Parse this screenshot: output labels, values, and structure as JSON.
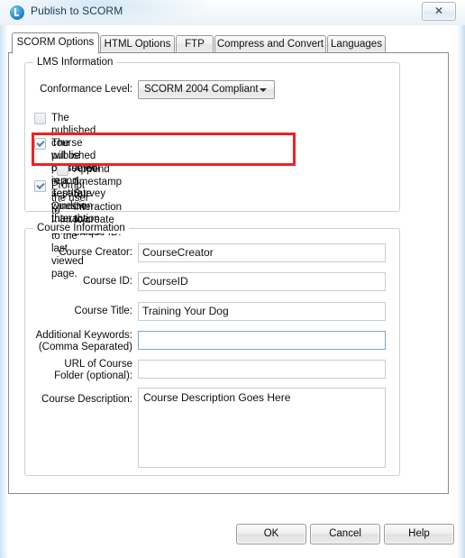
{
  "window": {
    "title": "Publish to SCORM",
    "app_icon": "lectora-logo-icon",
    "close_label": "✕"
  },
  "tabs": [
    {
      "label": "SCORM Options",
      "active": true
    },
    {
      "label": "HTML Options",
      "active": false
    },
    {
      "label": "FTP",
      "active": false
    },
    {
      "label": "Compress and Convert",
      "active": false
    },
    {
      "label": "Languages",
      "active": false
    }
  ],
  "lms_information": {
    "group_label": "LMS Information",
    "conformance_label": "Conformance Level:",
    "conformance_value": "SCORM 2004 Compliant",
    "checkboxes": [
      {
        "label": "The published course will be presented in a separate\nwindow than the LMS.",
        "checked": false,
        "indented": false
      },
      {
        "label": "The published course will report Test/Survey Question\nInteraction to the LMS.",
        "checked": true,
        "indented": false
      },
      {
        "label": "Append timestamp to interaction to create unique ID.",
        "checked": false,
        "indented": true
      },
      {
        "label": "Prompt the user to navigate to the last viewed page.",
        "checked": true,
        "indented": false
      }
    ]
  },
  "course_information": {
    "group_label": "Course Information",
    "fields": [
      {
        "label": "Course Creator:",
        "value": "CourseCreator",
        "placeholder": "",
        "focused": false
      },
      {
        "label": "Course ID:",
        "value": "CourseID",
        "placeholder": "",
        "focused": false
      },
      {
        "label": "Course Title:",
        "value": "Training Your Dog",
        "placeholder": "",
        "focused": false
      },
      {
        "label": "Additional Keywords:\n(Comma Separated)",
        "value": "",
        "placeholder": "",
        "focused": true
      },
      {
        "label": "URL of Course\nFolder (optional):",
        "value": "",
        "placeholder": "",
        "focused": false
      }
    ],
    "description_label": "Course Description:",
    "description_value": "Course Description Goes Here"
  },
  "footer": {
    "ok_label": "OK",
    "cancel_label": "Cancel",
    "help_label": "Help"
  },
  "annotation": {
    "highlight_color": "#ee2222",
    "highlight_target": "report-test-survey-question-interaction-checkbox"
  }
}
